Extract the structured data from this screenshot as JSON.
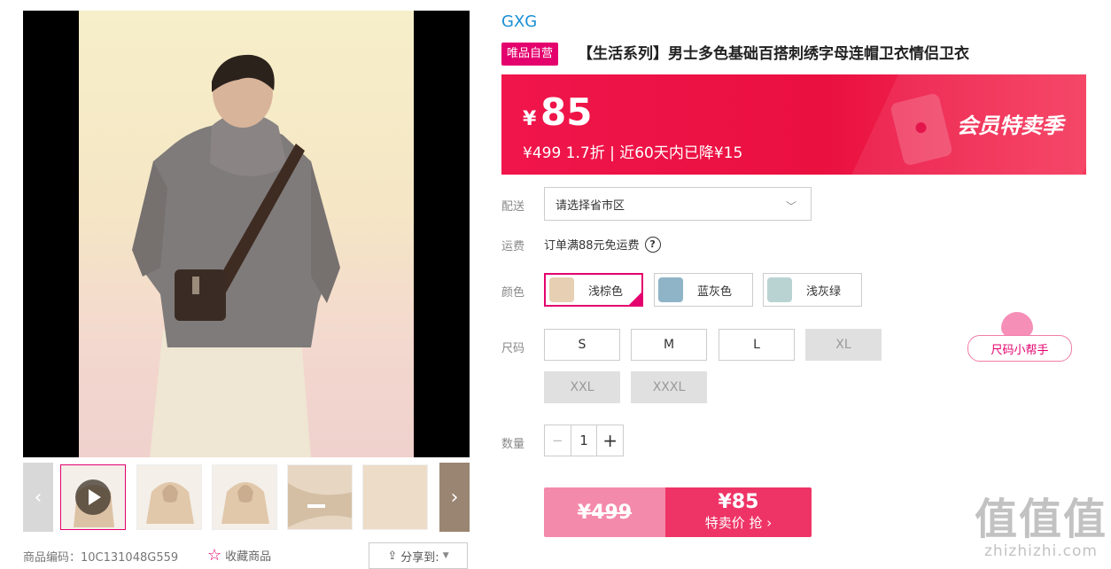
{
  "gallery": {
    "thumbnail_count": 6,
    "prev_arrow": "‹",
    "next_arrow": "›"
  },
  "product_code": "商品编码：10C131048G559",
  "favorite_label": "收藏商品",
  "share_label": "分享到:",
  "brand": "GXG",
  "self_operated_tag": "唯品自营",
  "title": "【生活系列】男士多色基础百搭刺绣字母连帽卫衣情侣卫衣",
  "price": {
    "currency": "¥",
    "current": "85",
    "subline": "¥499 1.7折 | 近60天内已降¥15",
    "promo_label": "会员特卖季"
  },
  "delivery": {
    "label": "配送",
    "placeholder": "请选择省市区"
  },
  "shipping": {
    "label": "运费",
    "text": "订单满88元免运费",
    "help": "?"
  },
  "colors": {
    "label": "颜色",
    "options": [
      {
        "name": "浅棕色",
        "swatch": "#e6cfb3",
        "selected": true
      },
      {
        "name": "蓝灰色",
        "swatch": "#8fb4c7",
        "selected": false
      },
      {
        "name": "浅灰绿",
        "swatch": "#b9d3d2",
        "selected": false
      }
    ]
  },
  "sizes": {
    "label": "尺码",
    "options": [
      {
        "name": "S",
        "available": true
      },
      {
        "name": "M",
        "available": true
      },
      {
        "name": "L",
        "available": true
      },
      {
        "name": "XL",
        "available": false
      },
      {
        "name": "XXL",
        "available": false
      },
      {
        "name": "XXXL",
        "available": false
      }
    ],
    "helper": "尺码小帮手"
  },
  "quantity": {
    "label": "数量",
    "value": "1",
    "minus": "−",
    "plus": "+"
  },
  "buy": {
    "original": "¥499",
    "special_price": "¥85",
    "cta": "特卖价 抢 ›"
  },
  "watermark": {
    "big": "值值值",
    "small": "zhizhizhi.com"
  },
  "colors_theme": {
    "accent": "#e4006d",
    "price_red": "#ea1040",
    "brand_blue": "#1a8fd4"
  }
}
